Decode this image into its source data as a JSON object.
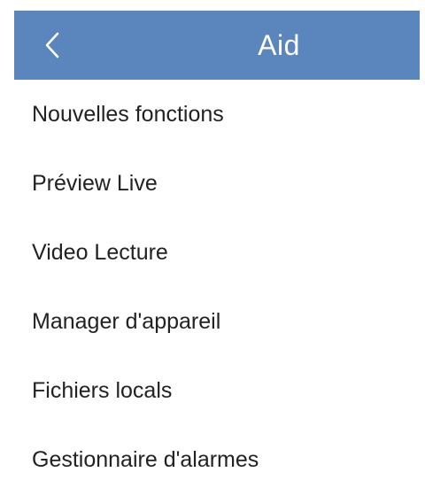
{
  "header": {
    "title": "Aid",
    "back_icon": "chevron-left-icon",
    "background_color": "#5a86bd"
  },
  "menu": {
    "items": [
      {
        "label": "Nouvelles fonctions"
      },
      {
        "label": "Préview Live"
      },
      {
        "label": "Video Lecture"
      },
      {
        "label": "Manager d'appareil"
      },
      {
        "label": "Fichiers locals"
      },
      {
        "label": "Gestionnaire d'alarmes"
      }
    ]
  }
}
